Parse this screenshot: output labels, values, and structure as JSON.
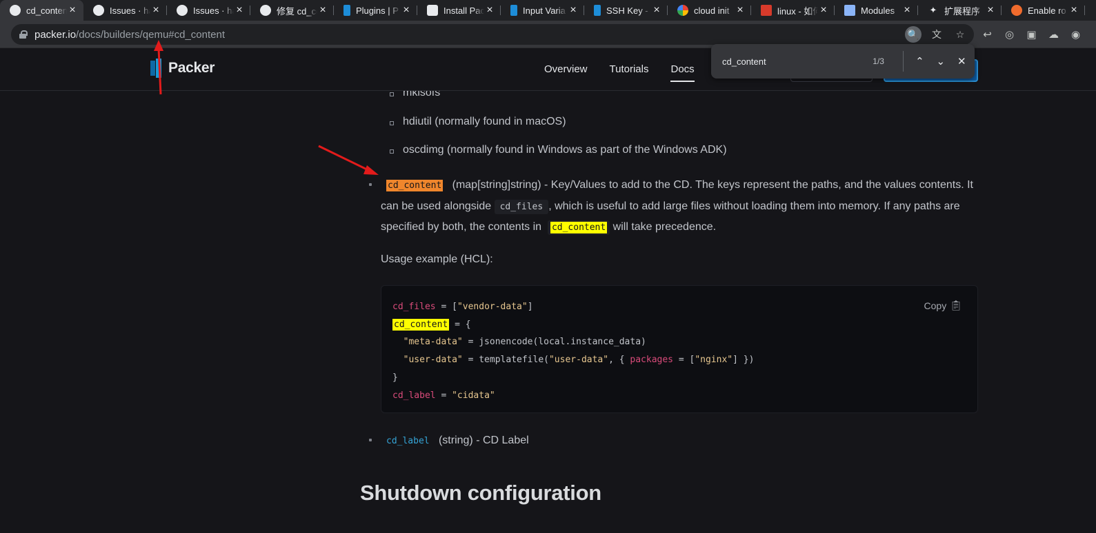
{
  "tabs": [
    {
      "title": "cd_content",
      "icon": "github-icon",
      "active": true
    },
    {
      "title": "Issues · ha",
      "icon": "github-icon"
    },
    {
      "title": "Issues · ha",
      "icon": "github-icon"
    },
    {
      "title": "修复 cd_co",
      "icon": "github-icon"
    },
    {
      "title": "Plugins | P",
      "icon": "packer-icon"
    },
    {
      "title": "Install Pac",
      "icon": "hashicorp-icon"
    },
    {
      "title": "Input Varia",
      "icon": "packer-icon"
    },
    {
      "title": "SSH Key -",
      "icon": "packer-icon"
    },
    {
      "title": "cloud init",
      "icon": "google-icon"
    },
    {
      "title": "linux - 如何",
      "icon": "csdn-icon"
    },
    {
      "title": "Modules",
      "icon": "modules-icon"
    },
    {
      "title": "扩展程序",
      "icon": "extension-icon"
    },
    {
      "title": "Enable ro",
      "icon": "ubuntu-icon"
    }
  ],
  "address": {
    "domain": "packer.io",
    "path": "/docs/builders/qemu#cd_content"
  },
  "site": {
    "logo": "Packer",
    "nav": [
      "Overview",
      "Tutorials",
      "Docs"
    ]
  },
  "find": {
    "query": "cd_content",
    "count": "1/3"
  },
  "docs": {
    "sub_items": [
      "mkisofs",
      "hdiutil (normally found in macOS)",
      "oscdimg (normally found in Windows as part of the Windows ADK)"
    ],
    "cd_content": {
      "name": "cd_content",
      "type": "(map[string]string)",
      "desc1": " - Key/Values to add to the CD. The keys represent the paths, and the values contents. It can be used alongside ",
      "inline1": "cd_files",
      "desc2": ", which is useful to add large files without loading them into memory. If any paths are specified by both, the contents in ",
      "inline2": "cd_content",
      "desc3": " will take precedence."
    },
    "usage_label": "Usage example (HCL):",
    "copy_label": "Copy",
    "cd_label": {
      "name": "cd_label",
      "type": "(string)",
      "desc": " - CD Label"
    },
    "next_heading": "Shutdown configuration"
  },
  "colors": {
    "find_current": "#f0862c",
    "find_match": "#ffff00",
    "annotation_arrow": "#e31b1b"
  }
}
